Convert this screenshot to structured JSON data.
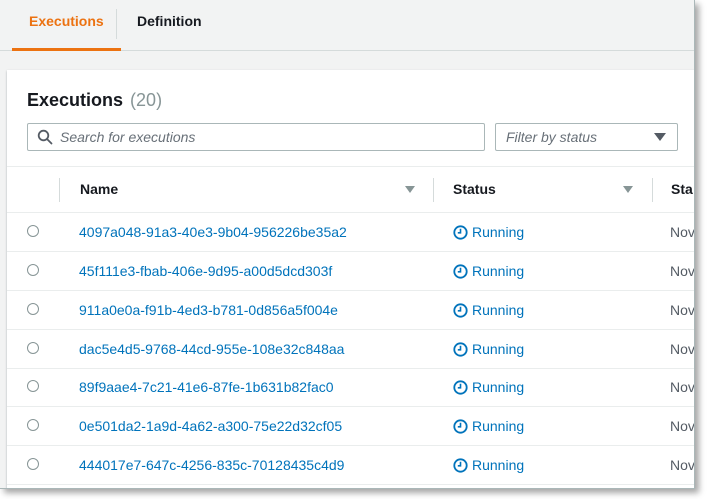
{
  "tabs": [
    {
      "label": "Executions",
      "active": true
    },
    {
      "label": "Definition",
      "active": false
    }
  ],
  "panel": {
    "title": "Executions",
    "count": "(20)"
  },
  "search": {
    "placeholder": "Search for executions"
  },
  "filter": {
    "placeholder": "Filter by status"
  },
  "columns": {
    "name": "Name",
    "status": "Status",
    "started": "Sta"
  },
  "rows": [
    {
      "name": "4097a048-91a3-40e3-9b04-956226be35a2",
      "status": "Running",
      "started": "Nov"
    },
    {
      "name": "45f111e3-fbab-406e-9d95-a00d5dcd303f",
      "status": "Running",
      "started": "Nov"
    },
    {
      "name": "911a0e0a-f91b-4ed3-b781-0d856a5f004e",
      "status": "Running",
      "started": "Nov"
    },
    {
      "name": "dac5e4d5-9768-44cd-955e-108e32c848aa",
      "status": "Running",
      "started": "Nov"
    },
    {
      "name": "89f9aae4-7c21-41e6-87fe-1b631b82fac0",
      "status": "Running",
      "started": "Nov"
    },
    {
      "name": "0e501da2-1a9d-4a62-a300-75e22d32cf05",
      "status": "Running",
      "started": "Nov"
    },
    {
      "name": "444017e7-647c-4256-835c-70128435c4d9",
      "status": "Running",
      "started": "Nov"
    }
  ],
  "colors": {
    "accent": "#ec7211",
    "link": "#0073bb",
    "text": "#16191f",
    "muted": "#879596"
  },
  "icons": {
    "search": "search-icon",
    "filter": "caret-down-icon",
    "sort": "sort-caret-icon",
    "status": "clock-icon"
  }
}
